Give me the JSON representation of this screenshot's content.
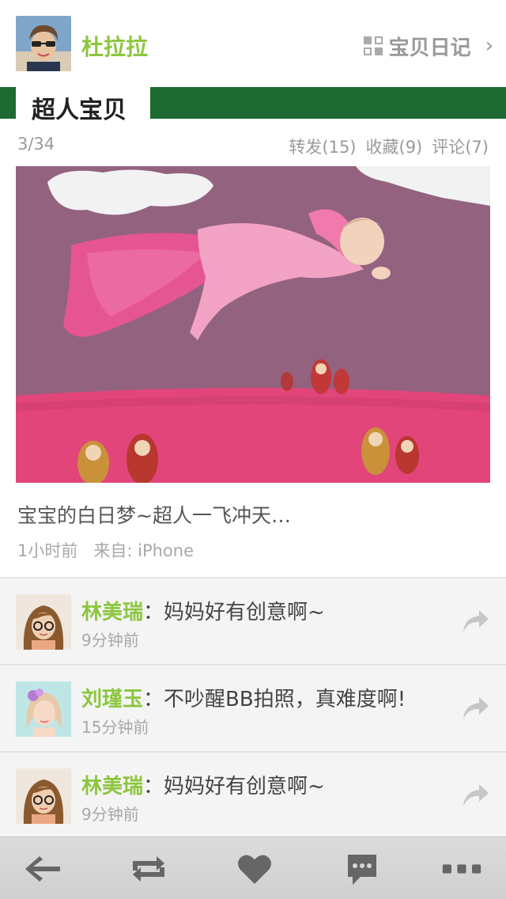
{
  "header": {
    "username": "杜拉拉",
    "diary_label": "宝贝日记",
    "chevron": "›"
  },
  "section": {
    "title": "超人宝贝"
  },
  "post": {
    "position": "3/34",
    "stats": [
      "转发(15)",
      "收藏(9)",
      "评论(7)"
    ],
    "caption": "宝宝的白日梦~超人一飞冲天…",
    "time": "1小时前",
    "source": "来自: iPhone"
  },
  "comments": [
    {
      "name": "林美瑞",
      "text": "：妈妈好有创意啊~",
      "time": "9分钟前",
      "avatar": "girl-glasses"
    },
    {
      "name": "刘瑾玉",
      "text": "：不吵醒BB拍照，真难度啊!",
      "time": "15分钟前",
      "avatar": "girl-flower"
    },
    {
      "name": "林美瑞",
      "text": "：妈妈好有创意啊~",
      "time": "9分钟前",
      "avatar": "girl-glasses"
    }
  ],
  "toolbar": {
    "icons": [
      "back-arrow-icon",
      "repost-icon",
      "heart-icon",
      "comment-icon",
      "more-icon"
    ]
  },
  "colors": {
    "accent_green": "#8cc63f",
    "section_bar": "#1d6a32",
    "toolbar_icon": "#666666"
  }
}
